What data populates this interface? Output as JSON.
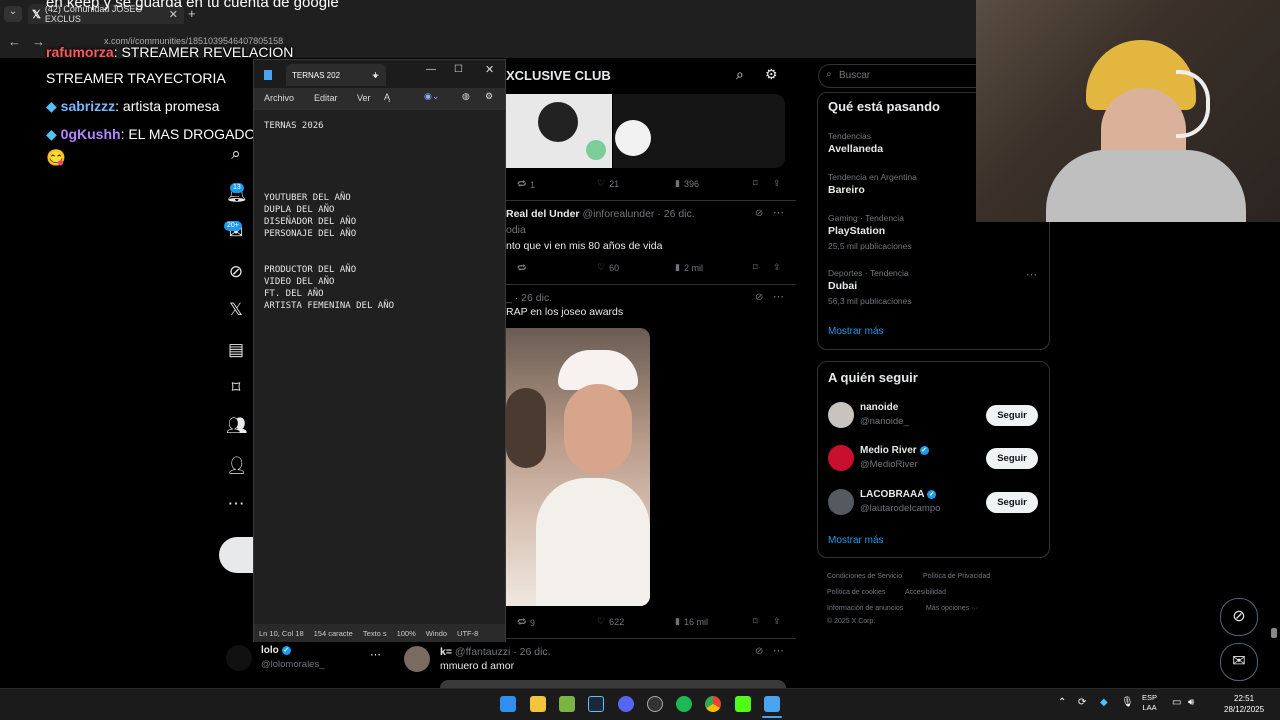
{
  "browser": {
    "tab_title": "(42) Comunidad JOSEO EXCLUS",
    "url": "x.com/i/communities/1851039546407805158",
    "overlay_top_text": "en keep y se guarda en tu cuenta de google"
  },
  "stream_chat": [
    {
      "user": "rafumorza",
      "text": ": STREAMER REVELACION"
    },
    {
      "user": "",
      "text": "STREAMER TRAYECTORIA"
    },
    {
      "user": "sabrizzz",
      "text": ": artista promesa"
    },
    {
      "user": "0gKushh",
      "text": ": EL MAS DROGADO DEL AÑO"
    }
  ],
  "x_nav": {
    "notifications_badge": "13",
    "messages_badge": "20+"
  },
  "notepad": {
    "tab_title": "TERNAS 202",
    "menu": [
      "Archivo",
      "Editar",
      "Ver"
    ],
    "content": "TERNAS 2026\n\n\n\n\n\nYOUTUBER DEL AÑO\nDUPLA DEL AÑO\nDISEÑADOR DEL AÑO\nPERSONAJE DEL AÑO\n\n\nPRODUCTOR DEL AÑO\nVIDEO DEL AÑO\nFT. DEL AÑO\nARTISTA FEMENINA DEL AÑO",
    "status": {
      "position": "Ln 10, Col 18",
      "chars": "154 caracte",
      "format": "Texto s",
      "zoom": "100%",
      "line_ending": "Windo",
      "encoding": "UTF-8"
    }
  },
  "feed": {
    "header_title": "XCLUSIVE CLUB",
    "posts": [
      {
        "retweets": "1",
        "likes": "21",
        "views": "396"
      },
      {
        "author": "Real del Under",
        "handle": "@inforealunder",
        "date": "· 26 dic.",
        "sub": "odia",
        "text": "nto que vi en mis 80 años de vida",
        "likes": "60",
        "views": "2 mil"
      },
      {
        "date": "· 26 dic.",
        "handle_prefix": "_",
        "text": "RAP en los joseo awards",
        "retweets": "9",
        "likes": "622",
        "views": "16 mil"
      },
      {
        "author": "k=",
        "handle": "@ffantauzzi",
        "date": "· 26 dic.",
        "text": "mmuero d amor"
      }
    ],
    "account": {
      "name": "lolo",
      "handle": "@lolomorales_"
    }
  },
  "sidebar": {
    "search_placeholder": "Buscar",
    "trends_title": "Qué está pasando",
    "trends": [
      {
        "meta": "Tendencias",
        "name": "Avellaneda",
        "count": ""
      },
      {
        "meta": "Tendencia en Argentina",
        "name": "Bareiro",
        "count": ""
      },
      {
        "meta": "Gaming · Tendencia",
        "name": "PlayStation",
        "count": "25,5 mil publicaciones"
      },
      {
        "meta": "Deportes · Tendencia",
        "name": "Dubai",
        "count": "56,3 mil publicaciones"
      }
    ],
    "show_more": "Mostrar más",
    "follow_title": "A quién seguir",
    "follow": [
      {
        "name": "nanoide",
        "handle": "@nanoide_",
        "verified": false,
        "button": "Seguir",
        "color": "#c9c3c0"
      },
      {
        "name": "Medio River",
        "handle": "@MedioRiver",
        "verified": true,
        "button": "Seguir",
        "color": "#c8102e"
      },
      {
        "name": "LACOBRAAA",
        "handle": "@lautarodeIcampo",
        "verified": true,
        "button": "Seguir",
        "color": "#555a60"
      }
    ],
    "footer": [
      "Condiciones de Servicio",
      "Política de Privacidad",
      "Política de cookies",
      "Accesibilidad",
      "Información de anuncios",
      "Más opciones ···",
      "© 2025 X Corp."
    ]
  },
  "taskbar": {
    "lang_top": "ESP",
    "lang_bottom": "LAA",
    "time": "22:51",
    "date": "28/12/2025"
  },
  "colors": {
    "accent": "#1d9bf0",
    "notepad_icon": "#4aa3f0"
  }
}
